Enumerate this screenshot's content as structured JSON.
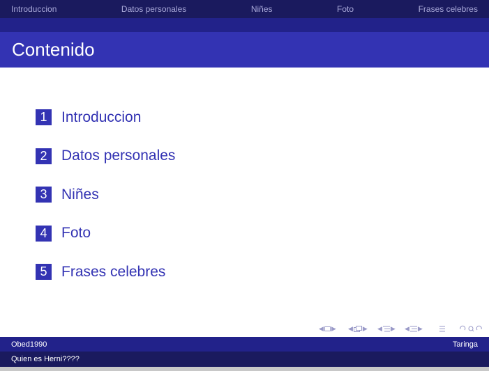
{
  "nav": {
    "items": [
      "Introduccion",
      "Datos personales",
      "Niñes",
      "Foto",
      "Frases celebres"
    ]
  },
  "frame": {
    "title": "Contenido"
  },
  "toc": {
    "items": [
      {
        "number": "1",
        "label": "Introduccion"
      },
      {
        "number": "2",
        "label": "Datos personales"
      },
      {
        "number": "3",
        "label": "Niñes"
      },
      {
        "number": "4",
        "label": "Foto"
      },
      {
        "number": "5",
        "label": "Frases celebres"
      }
    ]
  },
  "footer": {
    "author": "Obed1990",
    "institute": "Taringa",
    "title": "Quien es Herni????"
  },
  "icons": {
    "nav_controls": [
      "frame-nav-icon",
      "subsection-nav-icon",
      "section-nav-icon",
      "document-nav-icon",
      "appendix-icon",
      "search-icon"
    ]
  },
  "colors": {
    "nav_dark": "#1a1a5e",
    "nav_mid": "#22228a",
    "title_bar": "#3333b3",
    "accent_text": "#3333b3"
  }
}
